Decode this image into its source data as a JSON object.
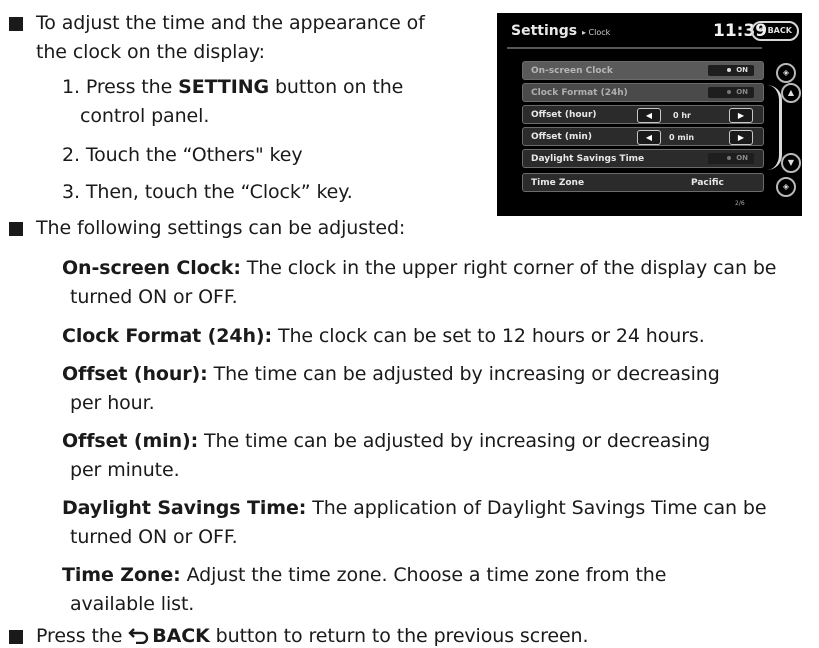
{
  "intro": {
    "line1": "To adjust the time and the appearance of",
    "line2": "the clock on the display:"
  },
  "steps": {
    "s1_pre": "1. Press the ",
    "s1_bold": "SETTING",
    "s1_post": " button on the",
    "s1_cont": "control panel.",
    "s2": "2. Touch the “Others\" key",
    "s3": "3. Then, touch the “Clock” key."
  },
  "settings_intro": "The following settings can be adjusted:",
  "items": [
    {
      "label": "On-screen Clock:",
      "text1": " The clock in the upper right corner of the display can be",
      "text2": "turned ON or OFF."
    },
    {
      "label": "Clock Format (24h):",
      "text1": " The clock can be set to 12 hours or 24 hours.",
      "text2": ""
    },
    {
      "label": "Offset (hour):",
      "text1": " The time can be adjusted by increasing or decreasing",
      "text2": "per hour."
    },
    {
      "label": "Offset (min):",
      "text1": " The time can be adjusted by increasing or decreasing",
      "text2": "per minute."
    },
    {
      "label": "Daylight Savings Time:",
      "text1": " The application of Daylight Savings Time can be",
      "text2": "turned ON or OFF."
    },
    {
      "label": "Time Zone:",
      "text1": " Adjust the time zone. Choose a time zone from the",
      "text2": "available list."
    }
  ],
  "back_note": {
    "pre": "Press the ",
    "bold": "BACK",
    "post": " button to return to the previous screen.",
    "icon": "back-arrow-icon"
  },
  "screen": {
    "title": "Settings",
    "crumb": "▸ Clock",
    "time": "11:39",
    "back_label": "BACK",
    "rows": [
      {
        "label": "On-screen Clock",
        "value": "ON"
      },
      {
        "label": "Clock Format (24h)",
        "value": "ON"
      },
      {
        "label": "Offset (hour)",
        "value": "0 hr"
      },
      {
        "label": "Offset (min)",
        "value": "0 min"
      },
      {
        "label": "Daylight Savings Time",
        "value": "ON"
      },
      {
        "label": "Time Zone",
        "value": "Pacific"
      }
    ],
    "page": "2/6"
  }
}
